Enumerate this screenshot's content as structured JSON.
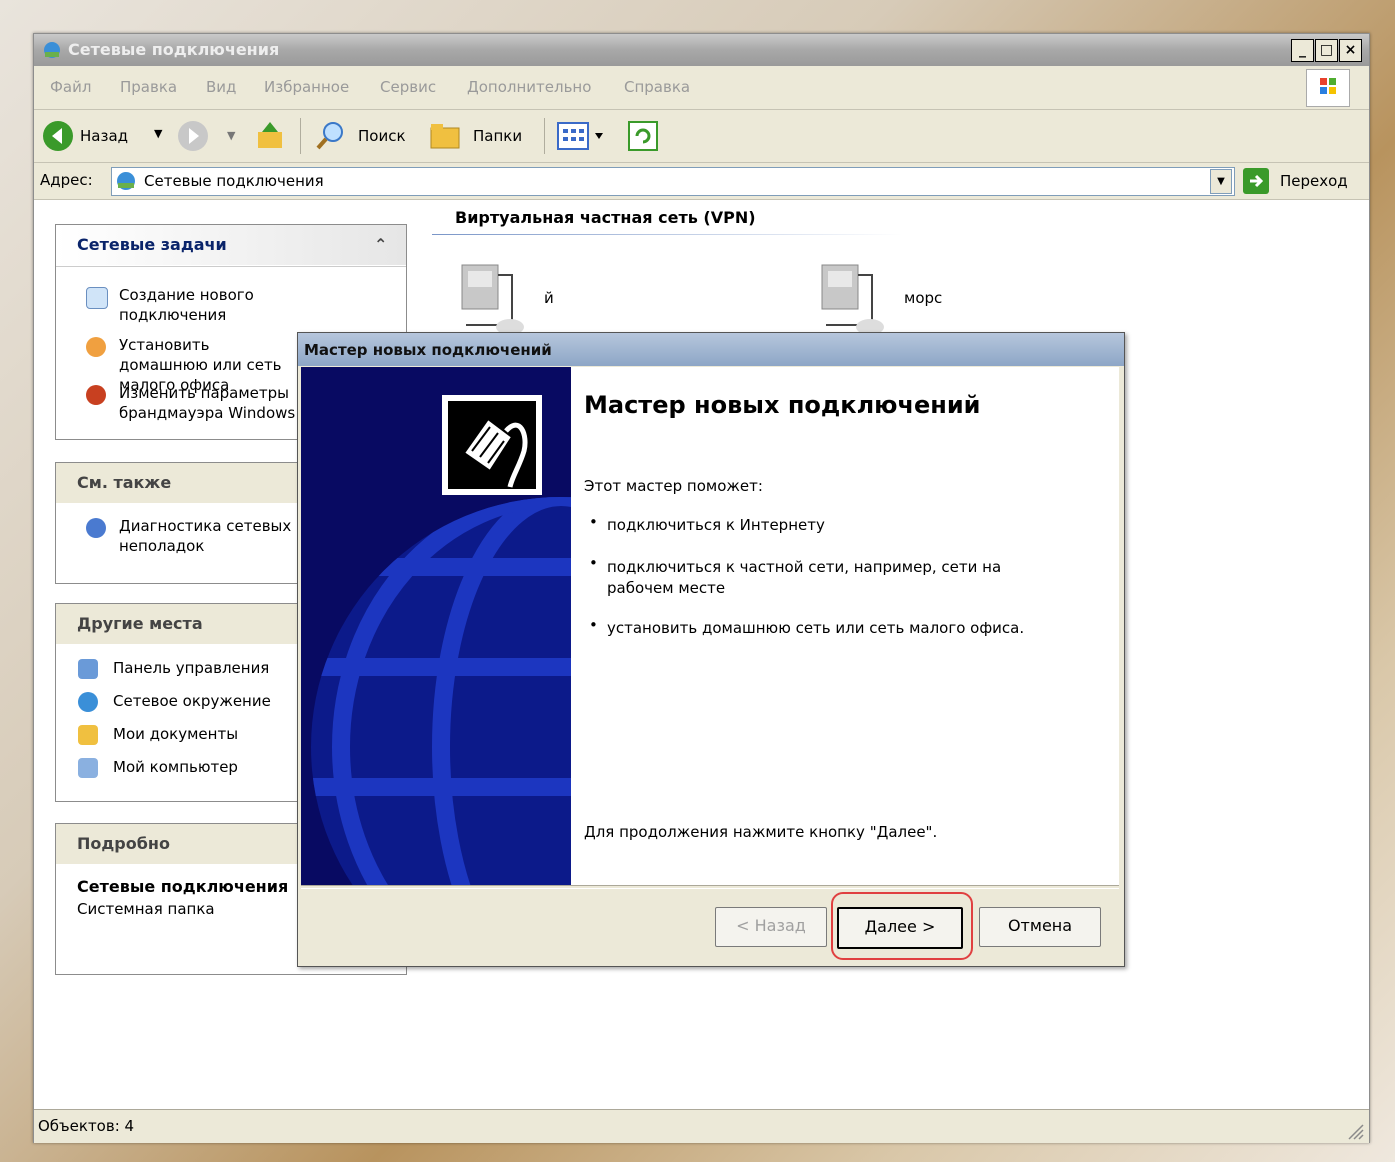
{
  "window": {
    "title": "Сетевые подключения"
  },
  "menu": [
    "Файл",
    "Правка",
    "Вид",
    "Избранное",
    "Сервис",
    "Дополнительно",
    "Справка"
  ],
  "toolbar": {
    "back": "Назад",
    "search": "Поиск",
    "folders": "Папки"
  },
  "address": {
    "label": "Адрес:",
    "value": "Сетевые подключения",
    "go": "Переход"
  },
  "section": {
    "title": "Виртуальная частная сеть (VPN)"
  },
  "connections": [
    {
      "name": "й"
    },
    {
      "name": "морс"
    }
  ],
  "tasks": {
    "title": "Сетевые задачи",
    "items": [
      "Создание нового подключения",
      "Установить домашнюю или сеть малого офиса",
      "Изменить параметры брандмауэра Windows"
    ]
  },
  "see_also": {
    "title": "См. также",
    "items": [
      "Диагностика сетевых неполадок"
    ]
  },
  "other_places": {
    "title": "Другие места",
    "items": [
      "Панель управления",
      "Сетевое окружение",
      "Мои документы",
      "Мой компьютер"
    ]
  },
  "details": {
    "title": "Подробно",
    "name": "Сетевые подключения",
    "type": "Системная папка"
  },
  "status": {
    "text": "Объектов: 4"
  },
  "wizard": {
    "window_title": "Мастер новых подключений",
    "heading": "Мастер новых подключений",
    "intro": "Этот мастер поможет:",
    "bullets": [
      "подключиться к Интернету",
      "подключиться к частной сети, например, сети на рабочем месте",
      "установить домашнюю сеть или сеть малого офиса."
    ],
    "footer": "Для продолжения нажмите кнопку \"Далее\".",
    "back": "< Назад",
    "next": "Далее >",
    "cancel": "Отмена"
  },
  "colors": {
    "accent": "#0a246a",
    "highlight": "#e04040",
    "wizard_side": "#080a62"
  }
}
